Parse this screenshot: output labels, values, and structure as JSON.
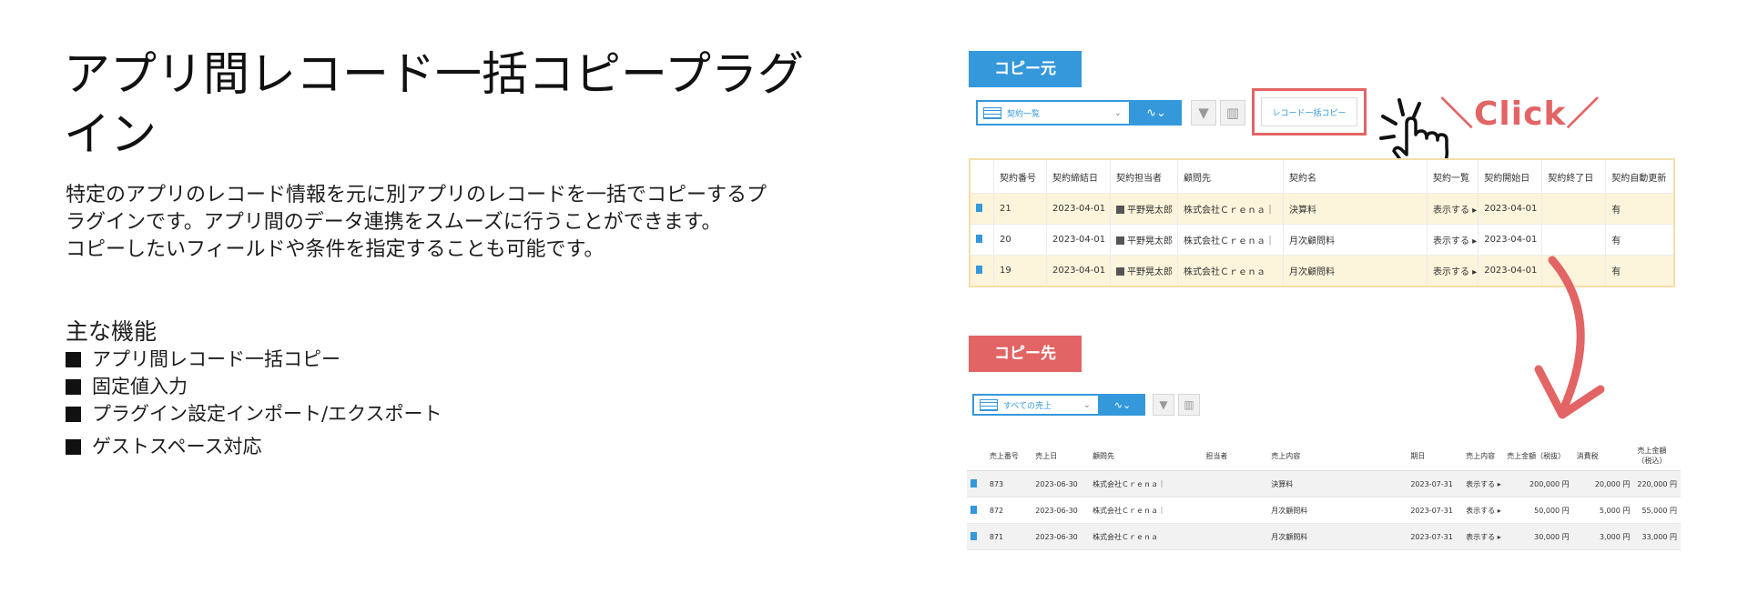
{
  "left": {
    "title": "アプリ間レコード一括コピープラグイン",
    "description": [
      "特定のアプリのレコード情報を元に別アプリのレコードを一括でコピーするプ",
      "ラグインです。アプリ間のデータ連携をスムーズに行うことができます。",
      "コピーしたいフィールドや条件を指定することも可能です。"
    ],
    "features_heading": "主な機能",
    "features": [
      "アプリ間レコード一括コピー",
      "固定値入力",
      "プラグイン設定インポート/エクスポート",
      "ゲストスペース対応"
    ]
  },
  "source": {
    "tag": "コピー元",
    "view": "契約一覧",
    "copy_button": "レコード一括コピー",
    "click_label": "＼Click／",
    "columns": [
      "",
      "契約番号",
      "契約締結日",
      "契約担当者",
      "顧問先",
      "契約名",
      "契約一覧",
      "契約開始日",
      "契約終了日",
      "契約自動更新"
    ],
    "rows": [
      {
        "no": "21",
        "date": "2023-04-01",
        "owner": "平野晃太郎",
        "client": "株式会社Ｃｒｅｎａ｜",
        "name": "決算料",
        "list": "表示する ▸",
        "start": "2023-04-01",
        "end": "",
        "auto": "有"
      },
      {
        "no": "20",
        "date": "2023-04-01",
        "owner": "平野晃太郎",
        "client": "株式会社Ｃｒｅｎａ｜",
        "name": "月次顧問料",
        "list": "表示する ▸",
        "start": "2023-04-01",
        "end": "",
        "auto": "有"
      },
      {
        "no": "19",
        "date": "2023-04-01",
        "owner": "平野晃太郎",
        "client": "株式会社Ｃｒｅｎａ",
        "name": "月次顧問料",
        "list": "表示する ▸",
        "start": "2023-04-01",
        "end": "",
        "auto": "有"
      }
    ]
  },
  "destination": {
    "tag": "コピー先",
    "view": "すべての売上",
    "columns": [
      "",
      "売上番号",
      "売上日",
      "顧問先",
      "担当者",
      "売上内容",
      "期日",
      "売上内容",
      "売上金額（税抜）",
      "消費税",
      "売上金額（税込）"
    ],
    "rows": [
      {
        "no": "873",
        "date": "2023-06-30",
        "client": "株式会社Ｃｒｅｎａ｜",
        "owner": "",
        "content": "決算料",
        "due": "2023-07-31",
        "detail": "表示する ▸",
        "net": "200,000 円",
        "tax": "20,000 円",
        "gross": "220,000 円"
      },
      {
        "no": "872",
        "date": "2023-06-30",
        "client": "株式会社Ｃｒｅｎａ｜",
        "owner": "",
        "content": "月次顧問料",
        "due": "2023-07-31",
        "detail": "表示する ▸",
        "net": "50,000 円",
        "tax": "5,000 円",
        "gross": "55,000 円"
      },
      {
        "no": "871",
        "date": "2023-06-30",
        "client": "株式会社Ｃｒｅｎａ",
        "owner": "",
        "content": "月次顧問料",
        "due": "2023-07-31",
        "detail": "表示する ▸",
        "net": "30,000 円",
        "tax": "3,000 円",
        "gross": "33,000 円"
      }
    ]
  },
  "colors": {
    "blue": "#3498db",
    "red": "#e36464",
    "row_highlight": "#fdf4dc"
  }
}
